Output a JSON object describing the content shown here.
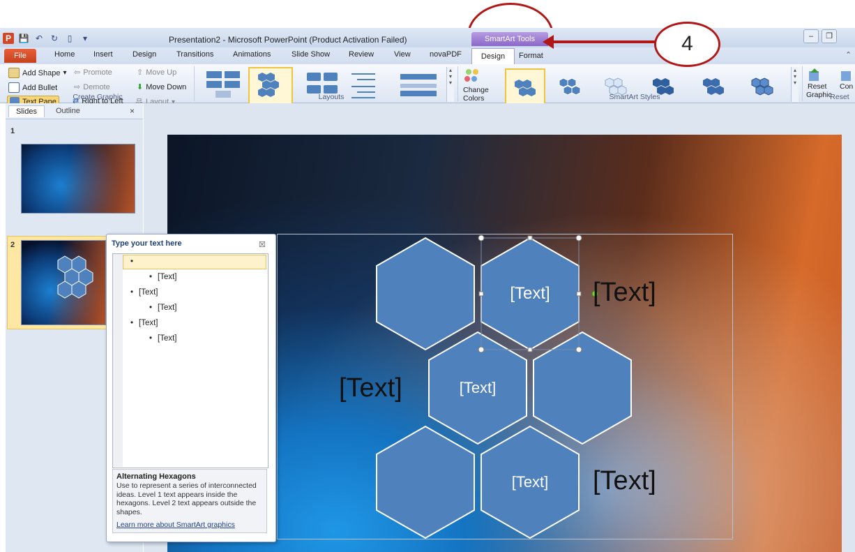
{
  "window": {
    "title": "Presentation2 - Microsoft PowerPoint (Product Activation Failed)",
    "contextual_tab_group": "SmartArt Tools"
  },
  "tabs": {
    "file": "File",
    "home": "Home",
    "insert": "Insert",
    "design": "Design",
    "transitions": "Transitions",
    "animations": "Animations",
    "slide_show": "Slide Show",
    "review": "Review",
    "view": "View",
    "novapdf": "novaPDF",
    "sa_design": "Design",
    "sa_format": "Format"
  },
  "ribbon": {
    "create_graphic": {
      "label": "Create Graphic",
      "add_shape": "Add Shape",
      "add_bullet": "Add Bullet",
      "text_pane": "Text Pane",
      "promote": "Promote",
      "demote": "Demote",
      "right_to_left": "Right to Left",
      "move_up": "Move Up",
      "move_down": "Move Down",
      "layout": "Layout"
    },
    "layouts": {
      "label": "Layouts"
    },
    "smartart_styles": {
      "label": "SmartArt Styles",
      "change_colors_1": "Change",
      "change_colors_2": "Colors"
    },
    "reset": {
      "label": "Reset",
      "reset_graphic_1": "Reset",
      "reset_graphic_2": "Graphic",
      "convert": "Con"
    }
  },
  "slide_pane": {
    "tab_slides": "Slides",
    "tab_outline": "Outline",
    "close": "×",
    "slide_numbers": [
      "1",
      "2"
    ]
  },
  "text_pane": {
    "title": "Type your text here",
    "close": "☒",
    "items": [
      {
        "level": 1,
        "text": ""
      },
      {
        "level": 2,
        "text": "[Text]"
      },
      {
        "level": 1,
        "text": "[Text]"
      },
      {
        "level": 2,
        "text": "[Text]"
      },
      {
        "level": 1,
        "text": "[Text]"
      },
      {
        "level": 2,
        "text": "[Text]"
      }
    ],
    "desc_title": "Alternating Hexagons",
    "desc_body": "Use to represent a series of interconnected ideas. Level 1 text appears inside the hexagons. Level 2 text appears outside the shapes.",
    "learn_more": "Learn more about SmartArt graphics"
  },
  "smartart": {
    "inside_labels": [
      "[Text]",
      "[Text]",
      "[Text]"
    ],
    "outside_labels": [
      "[Text]",
      "[Text]",
      "[Text]"
    ],
    "hex_fill": "#4f81bd",
    "hex_stroke": "#ffffff"
  },
  "callout": {
    "number": "4",
    "color": "#b01818"
  }
}
